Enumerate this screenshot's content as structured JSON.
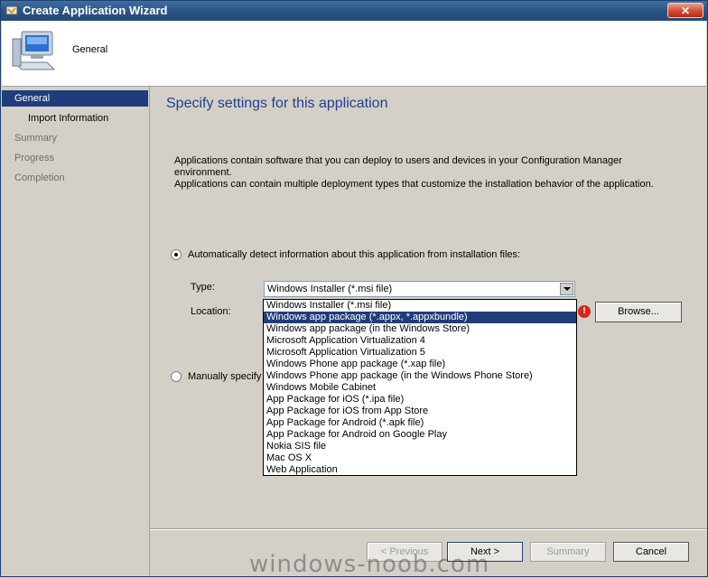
{
  "window": {
    "title": "Create Application Wizard"
  },
  "header": {
    "label": "General",
    "icon": "computer-icon"
  },
  "nav": {
    "items": [
      {
        "label": "General"
      },
      {
        "label": "Import Information"
      },
      {
        "label": "Summary"
      },
      {
        "label": "Progress"
      },
      {
        "label": "Completion"
      }
    ]
  },
  "main": {
    "heading": "Specify settings for this application",
    "description_line1": "Applications contain software that you can deploy to users and devices in your Configuration Manager environment.",
    "description_line2": "Applications can contain multiple deployment types that customize the installation behavior of the application.",
    "auto_detect_label": "Automatically detect information about this application from installation files:",
    "type_label": "Type:",
    "type_value": "Windows Installer (*.msi file)",
    "location_label": "Location:",
    "browse_label": "Browse...",
    "manual_label": "Manually specify t"
  },
  "dropdown": {
    "options": [
      "Windows Installer (*.msi file)",
      "Windows app package (*.appx, *.appxbundle)",
      "Windows app package (in the Windows Store)",
      "Microsoft Application Virtualization 4",
      "Microsoft Application Virtualization 5",
      "Windows Phone app package (*.xap file)",
      "Windows Phone app package (in the Windows Phone Store)",
      "Windows Mobile Cabinet",
      "App Package for iOS (*.ipa file)",
      "App Package for iOS from App Store",
      "App Package for Android (*.apk file)",
      "App Package for Android on Google Play",
      "Nokia SIS file",
      "Mac OS X",
      "Web Application"
    ],
    "selected_index": 1
  },
  "footer": {
    "previous_label": "< Previous",
    "next_label": "Next >",
    "summary_label": "Summary",
    "cancel_label": "Cancel"
  },
  "watermark": "windows-noob.com",
  "colors": {
    "accent": "#1f3d7a",
    "heading": "#1f3f8f",
    "error": "#d8261c"
  }
}
